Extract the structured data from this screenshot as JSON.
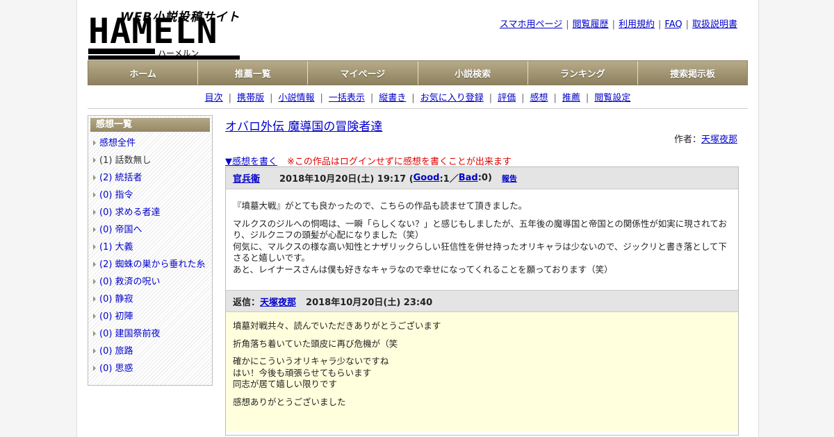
{
  "logo": {
    "tagline": "WEB小説投稿サイト",
    "name": "HAMELN",
    "kana": "ハーメルン"
  },
  "toplinks": [
    "スマホ用ページ",
    "閲覧履歴",
    "利用規約",
    "FAQ",
    "取扱説明書"
  ],
  "nav": [
    "ホーム",
    "推薦一覧",
    "マイページ",
    "小説検索",
    "ランキング",
    "捜索掲示板"
  ],
  "sublinks": [
    "目次",
    "携帯版",
    "小説情報",
    "一括表示",
    "縦書き",
    "お気に入り登録",
    "評価",
    "感想",
    "推薦",
    "閲覧設定"
  ],
  "sidebar": {
    "heading": "感想一覧",
    "items": [
      {
        "label": "感想全件",
        "link": true
      },
      {
        "label": "(1) 話数無し",
        "link": false
      },
      {
        "label": "(2) 統括者",
        "link": true
      },
      {
        "label": "(0) 指令",
        "link": true
      },
      {
        "label": "(0) 求める者達",
        "link": true
      },
      {
        "label": "(0) 帝国へ",
        "link": true
      },
      {
        "label": "(1) 大義",
        "link": true
      },
      {
        "label": "(2) 蜘蛛の巣から垂れた糸",
        "link": true
      },
      {
        "label": "(0) 救済の呪い",
        "link": true
      },
      {
        "label": "(0) 静寂",
        "link": true
      },
      {
        "label": "(0) 初陣",
        "link": true
      },
      {
        "label": "(0) 建国祭前夜",
        "link": true
      },
      {
        "label": "(0) 旅路",
        "link": true
      },
      {
        "label": "(0) 思惑",
        "link": true
      }
    ]
  },
  "novel": {
    "title": "オバロ外伝 魔導国の冒険者達",
    "author_label": "作者：",
    "author": "天塚夜那"
  },
  "write": {
    "link": "▼感想を書く",
    "note": "※この作品はログインせずに感想を書くことが出来ます"
  },
  "comment": {
    "user": "官兵衛",
    "date": "2018年10月20日(土) 19:17 (",
    "good": "Good",
    "good_count": ":1／",
    "bad": "Bad",
    "bad_count": ":0)",
    "report": "報告",
    "lines": [
      "『墳墓大戦』がとても良かったので、こちらの作品も読ませて頂きました。",
      "マルクスのジルへの恫喝は、一瞬「らしくない？」と感じもしましたが、五年後の魔導国と帝国との関係性が如実に現されており、ジルクニフの頭髪が心配になりました（笑）",
      "何気に、マルクスの様な高い知性とナザリックらしい狂信性を併せ持ったオリキャラは少ないので、ジックリと書き落として下さると嬉しいです。",
      "あと、レイナースさんは僕も好きなキャラなので幸せになってくれることを願っております（笑）"
    ]
  },
  "reply": {
    "label": "返信：",
    "user": "天塚夜那",
    "date": "2018年10月20日(土) 23:40",
    "lines": [
      "墳墓対戦共々、読んでいただきありがとうございます",
      "折角落ち着いていた頭皮に再び危機が（笑",
      "確かにこういうオリキャラ少ないですね",
      "はい！今後も頑張らせてもらいます",
      "同志が居て嬉しい限りです",
      "感想ありがとうございました"
    ]
  }
}
